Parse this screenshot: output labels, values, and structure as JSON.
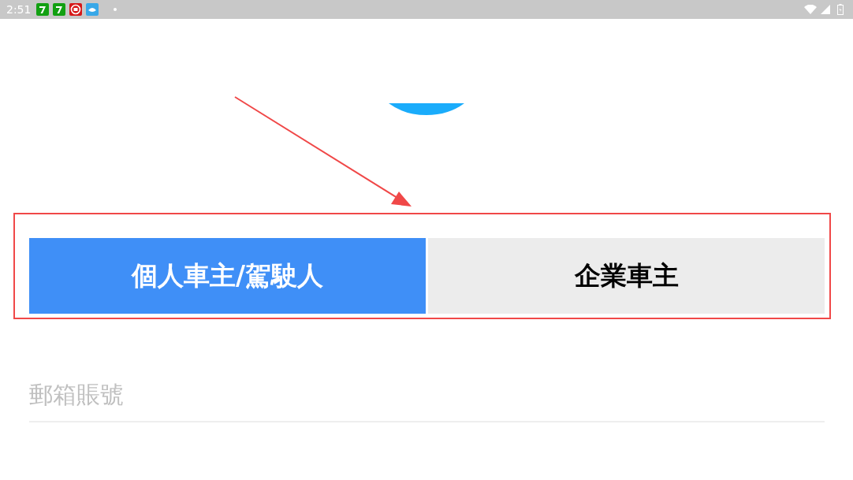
{
  "status_bar": {
    "time": "2:51"
  },
  "tabs": [
    {
      "label": "個人車主/駕駛人",
      "selected": true
    },
    {
      "label": "企業車主",
      "selected": false
    }
  ],
  "email_field": {
    "placeholder": "郵箱賬號"
  }
}
